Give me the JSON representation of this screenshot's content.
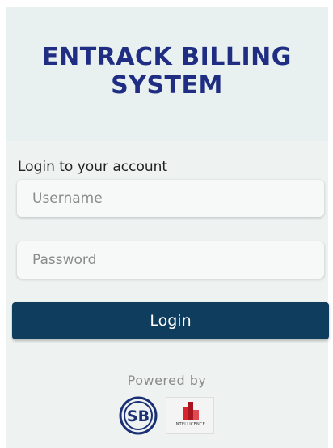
{
  "app": {
    "title_line1": "ENTRACK BILLING",
    "title_line2": "SYSTEM",
    "title_color": "#1f2d82"
  },
  "login": {
    "heading": "Login to your account",
    "username_placeholder": "Username",
    "password_placeholder": "Password",
    "button_label": "Login",
    "button_color": "#0f3d5e"
  },
  "footer": {
    "powered_by": "Powered by",
    "logos": [
      {
        "icon": "sb-logo-icon",
        "text": "SB"
      },
      {
        "icon": "intellicence-logo-icon",
        "text": "INTELLICENCE"
      }
    ]
  }
}
